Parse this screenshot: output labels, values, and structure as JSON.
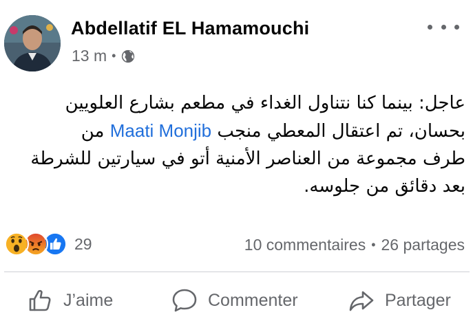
{
  "post": {
    "author": "Abdellatif EL Hamamouchi",
    "time": "13 m",
    "privacy_icon": "globe-icon",
    "text_line1": "عاجل: بينما كنا نتناول الغداء في مطعم بشارع العلويين",
    "text_line2_start": "بحسان، تم اعتقال المعطي منجب",
    "mention": "Maati Monjib",
    "text_line2_end": "من",
    "text_line3": "طرف مجموعة من العناصر الأمنية أتو في سيارتين للشرطة",
    "text_line4": "بعد دقائق من جلوسه."
  },
  "stats": {
    "reactions_count": "29",
    "reaction_icons": [
      "wow-icon",
      "angry-icon",
      "like-icon"
    ],
    "comments": "10 commentaires",
    "separator": "•",
    "shares": "26 partages"
  },
  "actions": {
    "like": "J’aime",
    "comment": "Commenter",
    "share": "Partager"
  },
  "colors": {
    "mention": "#216fdb",
    "secondary_text": "#65676b",
    "like_blue": "#1877f2",
    "angry_red": "#e9710f",
    "wow_yellow": "#f7b125"
  }
}
